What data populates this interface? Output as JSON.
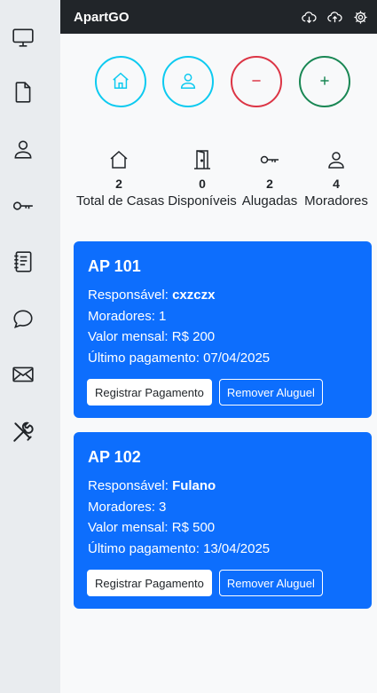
{
  "app": {
    "title": "ApartGO"
  },
  "topbar": {
    "icons": [
      "cloud-download-icon",
      "cloud-upload-icon",
      "gear-icon"
    ]
  },
  "sidebar": {
    "items": [
      {
        "icon": "monitor-icon"
      },
      {
        "icon": "file-icon"
      },
      {
        "icon": "person-icon"
      },
      {
        "icon": "key-icon"
      },
      {
        "icon": "journal-icon"
      },
      {
        "icon": "chat-icon"
      },
      {
        "icon": "envelope-icon"
      },
      {
        "icon": "tools-icon"
      }
    ]
  },
  "actions": {
    "colors": {
      "info": "#0dcaf0",
      "danger": "#dc3545",
      "success": "#198754"
    }
  },
  "stats": [
    {
      "icon": "house-icon",
      "value": "2",
      "label": "Total de Casas"
    },
    {
      "icon": "door-icon",
      "value": "0",
      "label": "Disponíveis"
    },
    {
      "icon": "key-icon",
      "value": "2",
      "label": "Alugadas"
    },
    {
      "icon": "person-icon",
      "value": "4",
      "label": "Moradores"
    }
  ],
  "cards": [
    {
      "title": "AP 101",
      "responsavel_label": "Responsável:",
      "responsavel": "cxzczx",
      "moradores": "Moradores: 1",
      "valor": "Valor mensal: R$ 200",
      "ultimo": "Último pagamento: 07/04/2025",
      "btn_registrar": "Registrar Pagamento",
      "btn_remover": "Remover Aluguel"
    },
    {
      "title": "AP 102",
      "responsavel_label": "Responsável:",
      "responsavel": "Fulano",
      "moradores": "Moradores: 3",
      "valor": "Valor mensal: R$ 500",
      "ultimo": "Último pagamento: 13/04/2025",
      "btn_registrar": "Registrar Pagamento",
      "btn_remover": "Remover Aluguel"
    }
  ],
  "theme": {
    "primary": "#0d6efd",
    "dark": "#212529",
    "sidebar": "#e9ecef"
  }
}
